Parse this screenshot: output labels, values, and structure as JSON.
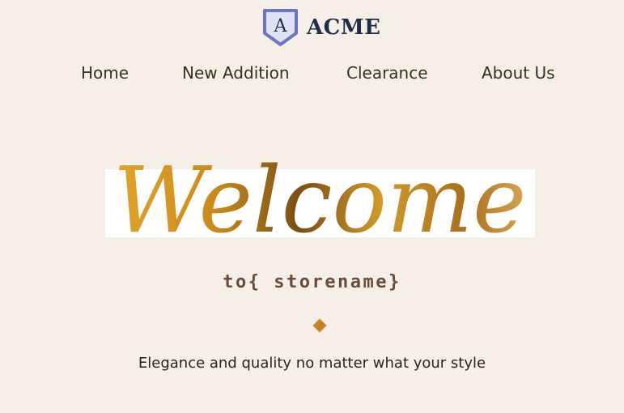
{
  "header": {
    "logo_letter": "A",
    "brand": "ACME"
  },
  "nav": {
    "items": [
      {
        "label": "Home"
      },
      {
        "label": "New Addition"
      },
      {
        "label": "Clearance"
      },
      {
        "label": "About Us"
      }
    ]
  },
  "hero": {
    "welcome": "Welcome",
    "subtitle": "to{ storename}",
    "tagline": "Elegance and quality no matter what your style"
  },
  "colors": {
    "background": "#f6efe7",
    "brand_text": "#1f2c4a",
    "logo_border": "#6c74c6",
    "gold": "#c8831e",
    "subtitle_text": "#6b4a37"
  },
  "icons": {
    "logo": "shield-logo-icon",
    "divider": "diamond-icon"
  }
}
